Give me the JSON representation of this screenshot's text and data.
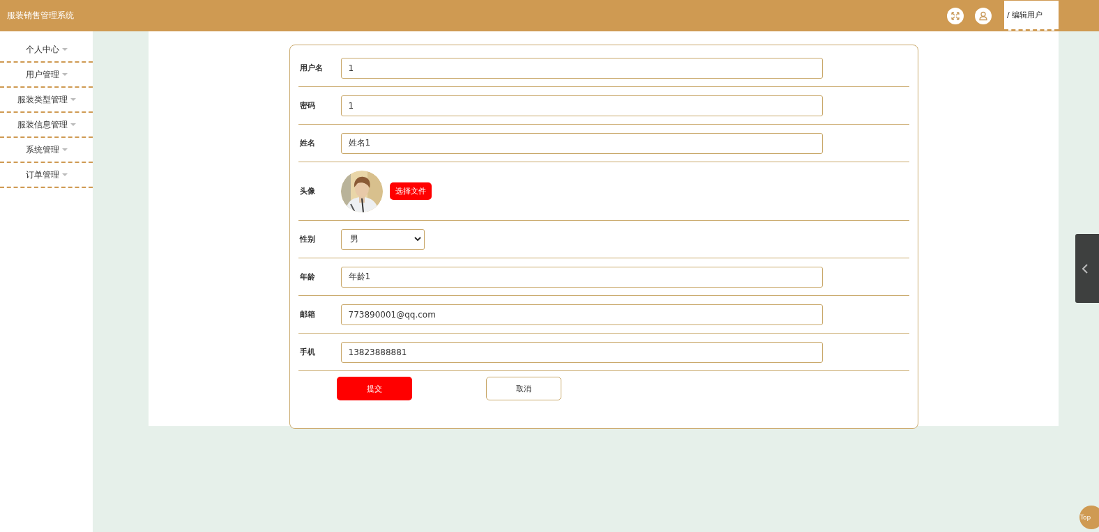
{
  "header": {
    "title": "服装销售管理系统",
    "breadcrumb": "/ 编辑用户"
  },
  "sidebar": {
    "items": [
      {
        "label": "个人中心"
      },
      {
        "label": "用户管理"
      },
      {
        "label": "服装类型管理"
      },
      {
        "label": "服装信息管理"
      },
      {
        "label": "系统管理"
      },
      {
        "label": "订单管理"
      }
    ]
  },
  "form": {
    "fields": [
      {
        "kind": "text",
        "label": "用户名",
        "value": "1"
      },
      {
        "kind": "text",
        "label": "密码",
        "value": "1"
      },
      {
        "kind": "text",
        "label": "姓名",
        "value": "姓名1"
      },
      {
        "kind": "avatar",
        "label": "头像",
        "button": "选择文件"
      },
      {
        "kind": "select",
        "label": "性别",
        "value": "男"
      },
      {
        "kind": "text",
        "label": "年龄",
        "value": "年龄1"
      },
      {
        "kind": "text",
        "label": "邮箱",
        "value": "773890001@qq.com"
      },
      {
        "kind": "text",
        "label": "手机",
        "value": "13823888881"
      }
    ],
    "buttons": [
      {
        "kind": "primary",
        "label": "提交"
      },
      {
        "kind": "plain",
        "label": "取消"
      }
    ]
  },
  "back_to_top": "Top"
}
